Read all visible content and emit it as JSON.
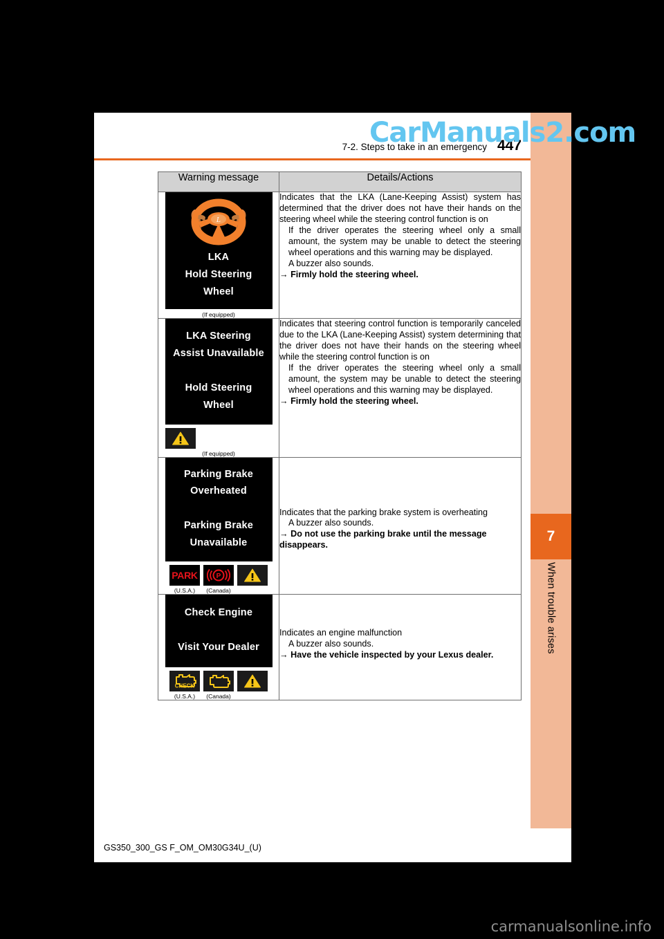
{
  "page": {
    "watermark": "CarManuals2.com",
    "header_title": "7-2. Steps to take in an emergency",
    "page_number": "447",
    "footer_code": "GS350_300_GS F_OM_OM30G34U_(U)",
    "bottom_banner": "carmanualsonline.info"
  },
  "tab": {
    "chapter_number": "7",
    "chapter_label": "When trouble arises"
  },
  "table": {
    "headers": {
      "message": "Warning message",
      "details": "Details/Actions"
    },
    "rows": [
      {
        "display_lines": [
          "LKA",
          "Hold Steering",
          "Wheel"
        ],
        "display_icon": "steering-wheel-hands-icon",
        "note": "(If equipped)",
        "indicators": [],
        "details": {
          "intro": "Indicates that the LKA (Lane-Keeping Assist) system has determined that the driver does not have their hands on the steering wheel while the steering control function is on",
          "sub": [
            "If the driver operates the steering wheel only a small amount, the system may be unable to detect the steering wheel operations and this warning may be displayed.",
            "A buzzer also sounds."
          ],
          "action": "Firmly hold the steering wheel."
        }
      },
      {
        "display_lines": [
          "LKA Steering",
          "Assist Unavailable",
          "",
          "Hold Steering",
          "Wheel"
        ],
        "display_icon": "",
        "note": "(If equipped)",
        "indicators": [
          {
            "type": "warning-triangle",
            "caption": ""
          }
        ],
        "details": {
          "intro": "Indicates that steering control function is temporarily canceled due to the LKA (Lane-Keeping Assist) system determining that the driver does not have their hands on the steering wheel while the steering control function is on",
          "sub": [
            "If the driver operates the steering wheel only a small amount, the system may be unable to detect the steering wheel operations and this warning may be displayed."
          ],
          "action": "Firmly hold the steering wheel."
        }
      },
      {
        "display_lines": [
          "Parking Brake",
          "Overheated",
          "",
          "Parking Brake",
          "Unavailable"
        ],
        "display_icon": "",
        "note": "",
        "indicators": [
          {
            "type": "park-text",
            "caption": "(U.S.A.)"
          },
          {
            "type": "park-brake-p",
            "caption": "(Canada)"
          },
          {
            "type": "warning-triangle",
            "caption": ""
          }
        ],
        "details": {
          "intro": "Indicates that the parking brake system is overheating",
          "sub": [
            "A buzzer also sounds."
          ],
          "action": "Do not use the parking brake until the message disappears."
        }
      },
      {
        "display_lines": [
          "Check Engine",
          "",
          "Visit Your Dealer"
        ],
        "display_icon": "",
        "note": "",
        "indicators": [
          {
            "type": "check-engine-usa",
            "caption": "(U.S.A.)"
          },
          {
            "type": "check-engine-canada",
            "caption": "(Canada)"
          },
          {
            "type": "warning-triangle",
            "caption": ""
          }
        ],
        "details": {
          "intro": "Indicates an engine malfunction",
          "sub": [
            "A buzzer also sounds."
          ],
          "action": "Have the vehicle inspected by your Lexus dealer."
        }
      }
    ]
  },
  "colors": {
    "accent_orange": "#e8671e",
    "tab_peach": "#f2b897",
    "warning_amber": "#f5c518",
    "alert_red": "#e8131b",
    "watermark_blue": "#63c6f0"
  }
}
